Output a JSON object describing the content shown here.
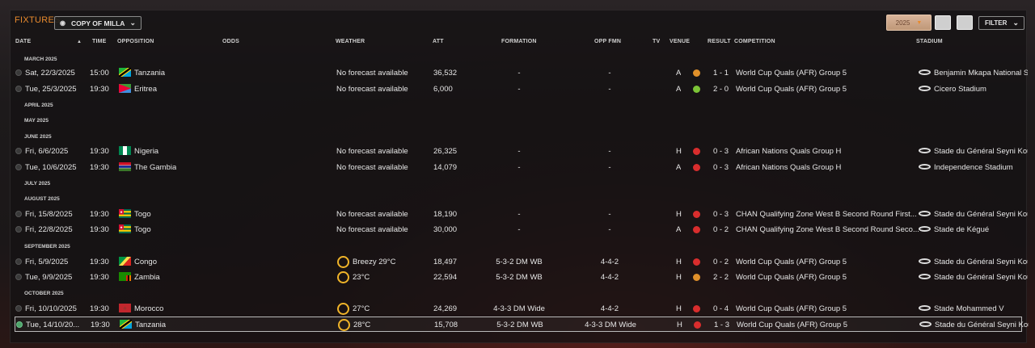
{
  "header": {
    "title": "FIXTURES",
    "view_label": "COPY OF MILLA",
    "year_label": "2025",
    "filter_label": "FILTER"
  },
  "columns": {
    "date": "DATE",
    "time": "TIME",
    "opposition": "OPPOSITION",
    "odds": "ODDS",
    "weather": "WEATHER",
    "att": "ATT",
    "formation": "FORMATION",
    "opp_fmn": "OPP FMN",
    "tv": "TV",
    "venue": "VENUE",
    "result": "RESULT",
    "competition": "COMPETITION",
    "stadium": "STADIUM"
  },
  "months": {
    "m1": "MARCH 2025",
    "m2": "APRIL 2025",
    "m3": "MAY 2025",
    "m4": "JUNE 2025",
    "m5": "JULY 2025",
    "m6": "AUGUST 2025",
    "m7": "SEPTEMBER 2025",
    "m8": "OCTOBER 2025"
  },
  "fixtures": [
    {
      "date": "Sat, 22/3/2025",
      "time": "15:00",
      "opp": "Tanzania",
      "weather": "No forecast available",
      "att": "36,532",
      "formation": "-",
      "opp_fmn": "-",
      "venue": "A",
      "result": "1 - 1",
      "competition": "World Cup Quals (AFR) Group 5",
      "stadium": "Benjamin Mkapa National S",
      "flag": "tanzania",
      "result_color": "#e0902a"
    },
    {
      "date": "Tue, 25/3/2025",
      "time": "19:30",
      "opp": "Eritrea",
      "weather": "No forecast available",
      "att": "6,000",
      "formation": "-",
      "opp_fmn": "-",
      "venue": "A",
      "result": "2 - 0",
      "competition": "World Cup Quals (AFR) Group 5",
      "stadium": "Cicero Stadium",
      "flag": "eritrea",
      "result_color": "#7cc437"
    },
    {
      "date": "Fri, 6/6/2025",
      "time": "19:30",
      "opp": "Nigeria",
      "weather": "No forecast available",
      "att": "26,325",
      "formation": "-",
      "opp_fmn": "-",
      "venue": "H",
      "result": "0 - 3",
      "competition": "African Nations Quals Group H",
      "stadium": "Stade du Général Seyni Kou",
      "flag": "nigeria",
      "result_color": "#d92d2d"
    },
    {
      "date": "Tue, 10/6/2025",
      "time": "19:30",
      "opp": "The Gambia",
      "weather": "No forecast available",
      "att": "14,079",
      "formation": "-",
      "opp_fmn": "-",
      "venue": "A",
      "result": "0 - 3",
      "competition": "African Nations Quals Group H",
      "stadium": "Independence Stadium",
      "flag": "gambia",
      "result_color": "#d92d2d"
    },
    {
      "date": "Fri, 15/8/2025",
      "time": "19:30",
      "opp": "Togo",
      "weather": "No forecast available",
      "att": "18,190",
      "formation": "-",
      "opp_fmn": "-",
      "venue": "H",
      "result": "0 - 3",
      "competition": "CHAN Qualifying Zone West B Second Round First...",
      "stadium": "Stade du Général Seyni Kou",
      "flag": "togo",
      "result_color": "#d92d2d"
    },
    {
      "date": "Fri, 22/8/2025",
      "time": "19:30",
      "opp": "Togo",
      "weather": "No forecast available",
      "att": "30,000",
      "formation": "-",
      "opp_fmn": "-",
      "venue": "A",
      "result": "0 - 2",
      "competition": "CHAN Qualifying Zone West B Second Round Seco...",
      "stadium": "Stade de Kégué",
      "flag": "togo",
      "result_color": "#d92d2d"
    },
    {
      "date": "Fri, 5/9/2025",
      "time": "19:30",
      "opp": "Congo",
      "weather": "Breezy 29°C",
      "att": "18,497",
      "formation": "5-3-2 DM WB",
      "opp_fmn": "4-4-2",
      "venue": "H",
      "result": "0 - 2",
      "competition": "World Cup Quals (AFR) Group 5",
      "stadium": "Stade du Général Seyni Kou",
      "flag": "congo",
      "result_color": "#d92d2d"
    },
    {
      "date": "Tue, 9/9/2025",
      "time": "19:30",
      "opp": "Zambia",
      "weather": "23°C",
      "att": "22,594",
      "formation": "5-3-2 DM WB",
      "opp_fmn": "4-4-2",
      "venue": "H",
      "result": "2 - 2",
      "competition": "World Cup Quals (AFR) Group 5",
      "stadium": "Stade du Général Seyni Kou",
      "flag": "zambia",
      "result_color": "#e0902a"
    },
    {
      "date": "Fri, 10/10/2025",
      "time": "19:30",
      "opp": "Morocco",
      "weather": "27°C",
      "att": "24,269",
      "formation": "4-3-3 DM Wide",
      "opp_fmn": "4-4-2",
      "venue": "H",
      "result": "0 - 4",
      "competition": "World Cup Quals (AFR) Group 5",
      "stadium": "Stade Mohammed V",
      "flag": "morocco",
      "result_color": "#d92d2d"
    },
    {
      "date": "Tue, 14/10/20...",
      "time": "19:30",
      "opp": "Tanzania",
      "weather": "28°C",
      "att": "15,708",
      "formation": "5-3-2 DM WB",
      "opp_fmn": "4-3-3 DM Wide",
      "venue": "H",
      "result": "1 - 3",
      "competition": "World Cup Quals (AFR) Group 5",
      "stadium": "Stade du Général Seyni Kou",
      "flag": "tanzania",
      "result_color": "#d92d2d"
    }
  ]
}
